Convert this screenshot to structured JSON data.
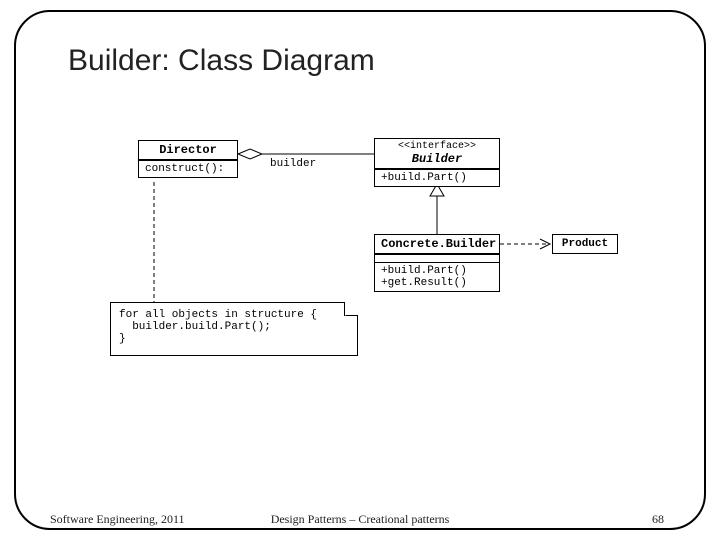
{
  "title": "Builder: Class Diagram",
  "director": {
    "name": "Director",
    "op": "construct():"
  },
  "builder": {
    "stereotype": "<<interface>>",
    "name": "Builder",
    "op": "+build.Part()"
  },
  "concrete": {
    "name": "Concrete.Builder",
    "op1": "+build.Part()",
    "op2": "+get.Result()"
  },
  "product": {
    "name": "Product"
  },
  "assoc_label": "builder",
  "note": {
    "line1": "for all objects in structure {",
    "line2": "  builder.build.Part();",
    "line3": "}"
  },
  "footer": {
    "left": "Software Engineering, 2011",
    "center": "Design Patterns – Creational patterns",
    "right": "68"
  }
}
